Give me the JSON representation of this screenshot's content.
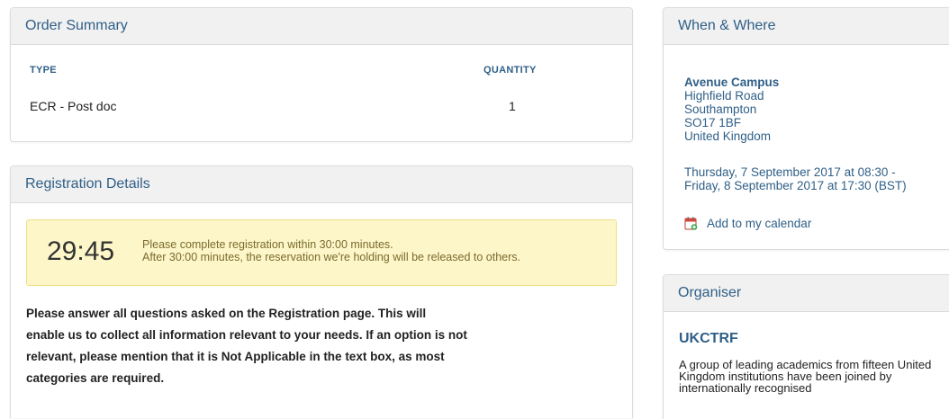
{
  "order_summary": {
    "title": "Order Summary",
    "col_type": "TYPE",
    "col_quantity": "QUANTITY",
    "rows": [
      {
        "type": "ECR - Post doc",
        "quantity": "1"
      }
    ]
  },
  "registration": {
    "title": "Registration Details",
    "timer": "29:45",
    "timer_line1": "Please complete registration within 30:00 minutes.",
    "timer_line2": "After 30:00 minutes, the reservation we're holding will be released to others.",
    "note": "Please answer all questions asked on the Registration page. This will enable us to collect all information relevant to your needs. If an option is not relevant, please mention that it is Not Applicable in the text box, as most categories are required."
  },
  "when_where": {
    "title": "When & Where",
    "venue_name": "Avenue Campus",
    "address_line1": "Highfield Road",
    "address_line2": "Southampton",
    "address_line3": "SO17 1BF",
    "address_line4": "United Kingdom",
    "date_line1": "Thursday, 7 September 2017 at 08:30 -",
    "date_line2": "Friday, 8 September 2017 at 17:30 (BST)",
    "calendar_label": "Add to my calendar",
    "calendar_icon": "calendar-add-icon"
  },
  "organiser": {
    "title": "Organiser",
    "name": "UKCTRF",
    "description": "A group of leading academics from fifteen United Kingdom institutions have been joined by internationally recognised"
  },
  "colors": {
    "heading_blue": "#2f5f87",
    "timer_bg": "#fdf6c8",
    "timer_border": "#eedf86",
    "panel_head_bg": "#f1f1f1"
  }
}
